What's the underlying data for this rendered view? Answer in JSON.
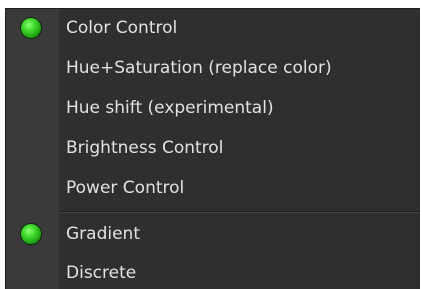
{
  "menu": {
    "items": [
      {
        "label": "Color Control",
        "checked": true
      },
      {
        "label": "Hue+Saturation (replace color)",
        "checked": false
      },
      {
        "label": "Hue shift (experimental)",
        "checked": false
      },
      {
        "label": "Brightness Control",
        "checked": false
      },
      {
        "label": "Power Control",
        "checked": false
      },
      {
        "label": "Gradient",
        "checked": true
      },
      {
        "label": "Discrete",
        "checked": false
      }
    ],
    "indicator_icon": "green-led-icon",
    "colors": {
      "background": "#2f2f2f",
      "gutter": "#3a3a3a",
      "text": "#e2e2e2",
      "indicator": "#3fd82a"
    }
  }
}
